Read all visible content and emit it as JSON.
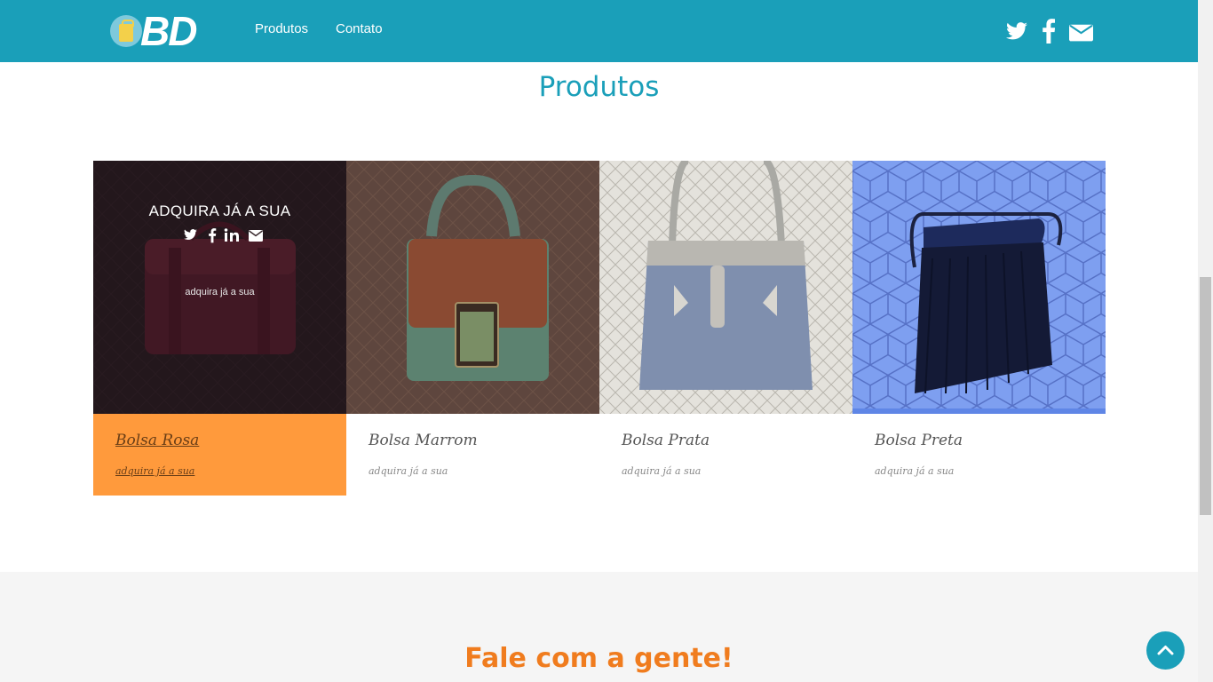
{
  "nav": {
    "logo_text": "BD",
    "links": [
      "Produtos",
      "Contato"
    ],
    "social_icons": [
      "twitter-icon",
      "facebook-icon",
      "envelope-icon"
    ]
  },
  "products_section": {
    "title": "Produtos",
    "overlay": {
      "title": "ADQUIRA JÁ A SUA",
      "subtitle": "adquira já a sua",
      "icons": [
        "twitter-icon",
        "facebook-icon",
        "linkedin-icon",
        "envelope-icon"
      ]
    },
    "items": [
      {
        "name": "Bolsa Rosa",
        "subtitle": "adquira já a sua",
        "active": true
      },
      {
        "name": "Bolsa Marrom",
        "subtitle": "adquira já a sua",
        "active": false
      },
      {
        "name": "Bolsa Prata",
        "subtitle": "adquira já a sua",
        "active": false
      },
      {
        "name": "Bolsa Preta",
        "subtitle": "adquira já a sua",
        "active": false
      }
    ]
  },
  "contact_section": {
    "title": "Fale com a gente!"
  },
  "colors": {
    "primary": "#1a9fb9",
    "accent_orange": "#ff9a3c",
    "contact_title": "#f07c1e"
  }
}
